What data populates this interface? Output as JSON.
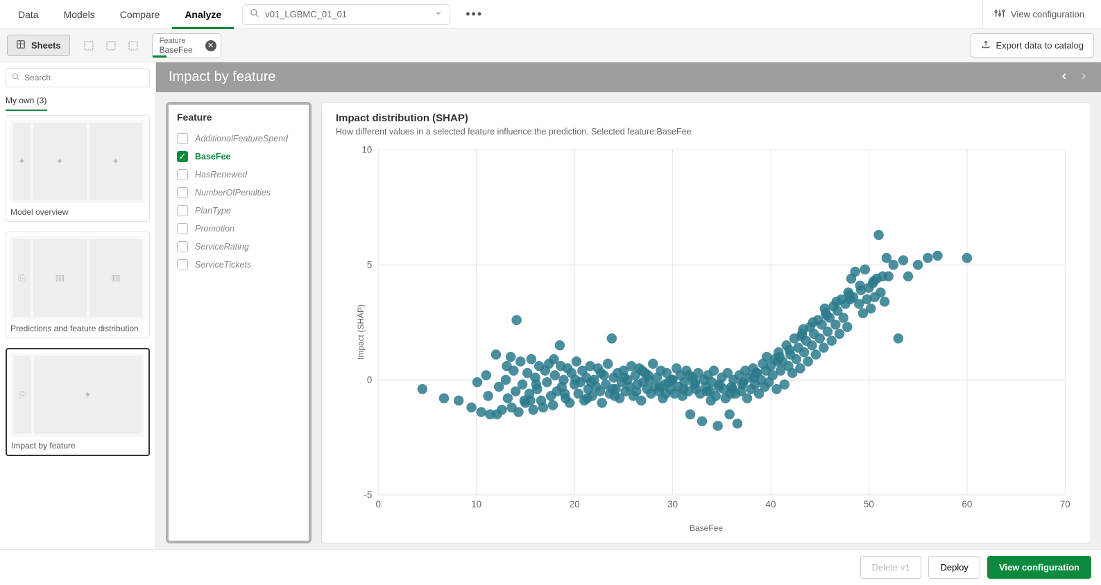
{
  "topnav": {
    "items": [
      "Data",
      "Models",
      "Compare",
      "Analyze"
    ],
    "active": 3
  },
  "model_dropdown": {
    "value": "v01_LGBMC_01_01"
  },
  "view_config_top": "View configuration",
  "sheets_btn": "Sheets",
  "feature_chip": {
    "label": "Feature",
    "value": "BaseFee"
  },
  "export_btn": "Export data to catalog",
  "search": {
    "placeholder": "Search"
  },
  "my_own": {
    "label": "My own (3)"
  },
  "sheets": [
    {
      "title": "Model overview"
    },
    {
      "title": "Predictions and feature distribution"
    },
    {
      "title": "Impact by feature"
    }
  ],
  "selected_sheet": 2,
  "canvas_header": "Impact by feature",
  "feature_panel": {
    "title": "Feature",
    "items": [
      {
        "label": "AdditionalFeatureSpend",
        "checked": false
      },
      {
        "label": "BaseFee",
        "checked": true
      },
      {
        "label": "HasRenewed",
        "checked": false
      },
      {
        "label": "NumberOfPenalties",
        "checked": false
      },
      {
        "label": "PlanType",
        "checked": false
      },
      {
        "label": "Promotion",
        "checked": false
      },
      {
        "label": "ServiceRating",
        "checked": false
      },
      {
        "label": "ServiceTickets",
        "checked": false
      }
    ]
  },
  "chart": {
    "title": "Impact distribution (SHAP)",
    "subtitle": "How different values in a selected feature influence the prediction. Selected feature:BaseFee"
  },
  "footer": {
    "delete": "Delete v1",
    "deploy": "Deploy",
    "view_config": "View configuration"
  },
  "chart_data": {
    "type": "scatter",
    "title": "Impact distribution (SHAP)",
    "xlabel": "BaseFee",
    "ylabel": "Impact (SHAP)",
    "xlim": [
      0,
      70
    ],
    "ylim": [
      -5,
      10
    ],
    "xticks": [
      0,
      10,
      20,
      30,
      40,
      50,
      60,
      70
    ],
    "yticks": [
      -5,
      0,
      5,
      10
    ],
    "point_color": "#2b7a8c",
    "points": [
      [
        4.5,
        -0.4
      ],
      [
        6.7,
        -0.8
      ],
      [
        8.2,
        -0.9
      ],
      [
        9.5,
        -1.2
      ],
      [
        10.1,
        -0.1
      ],
      [
        10.5,
        -1.4
      ],
      [
        11.0,
        0.2
      ],
      [
        11.2,
        -0.7
      ],
      [
        11.4,
        -1.5
      ],
      [
        12.0,
        1.1
      ],
      [
        12.1,
        -1.5
      ],
      [
        12.3,
        -0.3
      ],
      [
        12.6,
        -1.3
      ],
      [
        13.0,
        0.0
      ],
      [
        13.2,
        -0.8
      ],
      [
        13.5,
        1.0
      ],
      [
        13.6,
        -1.2
      ],
      [
        13.8,
        0.4
      ],
      [
        14.0,
        -0.5
      ],
      [
        14.1,
        2.6
      ],
      [
        14.3,
        -1.4
      ],
      [
        14.5,
        0.8
      ],
      [
        14.7,
        -0.2
      ],
      [
        15.0,
        -1.0
      ],
      [
        15.2,
        0.3
      ],
      [
        15.4,
        -0.6
      ],
      [
        15.6,
        0.9
      ],
      [
        15.8,
        -1.3
      ],
      [
        16.0,
        0.1
      ],
      [
        16.2,
        -0.4
      ],
      [
        16.4,
        0.6
      ],
      [
        16.6,
        -0.9
      ],
      [
        16.8,
        -1.2
      ],
      [
        17.0,
        0.4
      ],
      [
        17.2,
        -0.1
      ],
      [
        17.4,
        0.7
      ],
      [
        17.6,
        -0.7
      ],
      [
        17.8,
        -1.1
      ],
      [
        18.0,
        0.2
      ],
      [
        18.2,
        -0.5
      ],
      [
        18.5,
        1.5
      ],
      [
        18.7,
        -0.3
      ],
      [
        18.9,
        0.0
      ],
      [
        19.1,
        -0.8
      ],
      [
        19.3,
        0.5
      ],
      [
        19.5,
        -1.0
      ],
      [
        19.7,
        0.3
      ],
      [
        20.0,
        -0.2
      ],
      [
        20.2,
        0.8
      ],
      [
        20.4,
        -0.6
      ],
      [
        20.6,
        -0.1
      ],
      [
        20.8,
        0.4
      ],
      [
        21.0,
        -0.9
      ],
      [
        21.2,
        0.1
      ],
      [
        21.4,
        -0.4
      ],
      [
        21.6,
        0.6
      ],
      [
        21.8,
        -0.7
      ],
      [
        22.0,
        0.0
      ],
      [
        22.2,
        -0.3
      ],
      [
        22.4,
        0.5
      ],
      [
        22.6,
        -0.5
      ],
      [
        22.8,
        -1.0
      ],
      [
        23.0,
        0.2
      ],
      [
        23.2,
        -0.2
      ],
      [
        23.4,
        0.7
      ],
      [
        23.6,
        -0.6
      ],
      [
        23.8,
        1.8
      ],
      [
        24.0,
        0.1
      ],
      [
        24.2,
        -0.4
      ],
      [
        24.4,
        0.3
      ],
      [
        24.6,
        -0.8
      ],
      [
        24.8,
        -0.1
      ],
      [
        25.0,
        0.4
      ],
      [
        25.2,
        -0.5
      ],
      [
        25.4,
        0.0
      ],
      [
        25.6,
        -0.3
      ],
      [
        25.8,
        0.6
      ],
      [
        26.0,
        -0.7
      ],
      [
        26.2,
        0.2
      ],
      [
        26.4,
        -0.2
      ],
      [
        26.6,
        0.5
      ],
      [
        26.8,
        -0.9
      ],
      [
        27.0,
        -0.1
      ],
      [
        27.2,
        0.3
      ],
      [
        27.4,
        -0.4
      ],
      [
        27.6,
        0.0
      ],
      [
        27.8,
        -0.6
      ],
      [
        28.0,
        0.7
      ],
      [
        28.2,
        -0.3
      ],
      [
        28.4,
        0.1
      ],
      [
        28.6,
        -0.5
      ],
      [
        28.8,
        0.4
      ],
      [
        29.0,
        -0.8
      ],
      [
        29.2,
        -0.2
      ],
      [
        29.4,
        0.3
      ],
      [
        29.6,
        -0.1
      ],
      [
        29.8,
        -0.4
      ],
      [
        30.0,
        0.0
      ],
      [
        30.2,
        -0.6
      ],
      [
        30.4,
        0.5
      ],
      [
        30.6,
        -0.3
      ],
      [
        30.8,
        0.2
      ],
      [
        31.0,
        -0.7
      ],
      [
        31.2,
        -0.1
      ],
      [
        31.4,
        0.4
      ],
      [
        31.6,
        -0.5
      ],
      [
        31.8,
        -1.5
      ],
      [
        32.0,
        0.1
      ],
      [
        32.2,
        -0.2
      ],
      [
        32.4,
        -0.4
      ],
      [
        32.6,
        0.3
      ],
      [
        32.8,
        -0.6
      ],
      [
        33.0,
        -1.8
      ],
      [
        33.2,
        0.0
      ],
      [
        33.4,
        -0.3
      ],
      [
        33.6,
        0.2
      ],
      [
        33.8,
        -0.5
      ],
      [
        34.0,
        -0.1
      ],
      [
        34.2,
        0.4
      ],
      [
        34.4,
        -0.7
      ],
      [
        34.6,
        -2.0
      ],
      [
        34.8,
        -0.2
      ],
      [
        35.0,
        0.1
      ],
      [
        35.2,
        -0.4
      ],
      [
        35.4,
        -0.8
      ],
      [
        35.6,
        0.3
      ],
      [
        35.8,
        -1.5
      ],
      [
        36.0,
        -0.3
      ],
      [
        36.2,
        0.0
      ],
      [
        36.4,
        -0.6
      ],
      [
        36.6,
        -1.9
      ],
      [
        36.8,
        0.2
      ],
      [
        37.0,
        -0.5
      ],
      [
        37.2,
        -0.1
      ],
      [
        37.4,
        0.4
      ],
      [
        37.6,
        -0.8
      ],
      [
        37.8,
        0.1
      ],
      [
        38.0,
        -0.4
      ],
      [
        38.2,
        0.5
      ],
      [
        38.4,
        -0.2
      ],
      [
        38.6,
        0.3
      ],
      [
        38.8,
        -0.6
      ],
      [
        39.0,
        0.0
      ],
      [
        39.2,
        0.7
      ],
      [
        39.4,
        -0.3
      ],
      [
        39.6,
        1.0
      ],
      [
        39.8,
        -0.1
      ],
      [
        40.0,
        0.6
      ],
      [
        40.2,
        0.2
      ],
      [
        40.4,
        0.9
      ],
      [
        40.6,
        -0.4
      ],
      [
        40.8,
        1.2
      ],
      [
        41.0,
        0.4
      ],
      [
        41.2,
        0.8
      ],
      [
        41.4,
        -0.2
      ],
      [
        41.6,
        1.5
      ],
      [
        41.8,
        0.6
      ],
      [
        42.0,
        1.1
      ],
      [
        42.2,
        0.3
      ],
      [
        42.4,
        1.8
      ],
      [
        42.6,
        0.9
      ],
      [
        42.8,
        1.4
      ],
      [
        43.0,
        0.5
      ],
      [
        43.2,
        2.0
      ],
      [
        43.4,
        1.2
      ],
      [
        43.6,
        1.7
      ],
      [
        43.8,
        0.8
      ],
      [
        44.0,
        2.3
      ],
      [
        44.2,
        1.5
      ],
      [
        44.4,
        2.0
      ],
      [
        44.6,
        1.1
      ],
      [
        44.8,
        2.6
      ],
      [
        45.0,
        1.8
      ],
      [
        45.2,
        2.4
      ],
      [
        45.4,
        1.4
      ],
      [
        45.6,
        2.9
      ],
      [
        45.8,
        2.1
      ],
      [
        46.0,
        2.7
      ],
      [
        46.2,
        1.7
      ],
      [
        46.4,
        3.2
      ],
      [
        46.6,
        2.4
      ],
      [
        46.8,
        3.0
      ],
      [
        47.0,
        2.0
      ],
      [
        47.2,
        3.5
      ],
      [
        47.4,
        2.7
      ],
      [
        47.6,
        3.3
      ],
      [
        47.8,
        2.3
      ],
      [
        48.0,
        3.7
      ],
      [
        48.2,
        4.4
      ],
      [
        48.4,
        3.6
      ],
      [
        48.6,
        4.7
      ],
      [
        49.0,
        3.3
      ],
      [
        49.2,
        3.9
      ],
      [
        49.4,
        2.9
      ],
      [
        49.6,
        4.8
      ],
      [
        49.8,
        3.5
      ],
      [
        50.0,
        4.0
      ],
      [
        50.2,
        3.1
      ],
      [
        50.4,
        4.2
      ],
      [
        50.6,
        3.6
      ],
      [
        50.8,
        4.4
      ],
      [
        51.0,
        6.3
      ],
      [
        51.2,
        3.8
      ],
      [
        51.4,
        4.5
      ],
      [
        51.6,
        3.4
      ],
      [
        51.8,
        5.3
      ],
      [
        52.0,
        4.5
      ],
      [
        52.5,
        5.0
      ],
      [
        53.0,
        1.8
      ],
      [
        53.5,
        5.2
      ],
      [
        54.0,
        4.5
      ],
      [
        55.0,
        5.0
      ],
      [
        56.0,
        5.3
      ],
      [
        57.0,
        5.4
      ],
      [
        60.0,
        5.3
      ],
      [
        13.1,
        0.6
      ],
      [
        14.9,
        -0.9
      ],
      [
        16.1,
        -0.2
      ],
      [
        17.9,
        0.9
      ],
      [
        19.0,
        -0.6
      ],
      [
        20.1,
        0.0
      ],
      [
        21.3,
        -0.8
      ],
      [
        22.7,
        0.3
      ],
      [
        23.9,
        -0.4
      ],
      [
        25.1,
        0.1
      ],
      [
        26.3,
        -0.5
      ],
      [
        27.5,
        0.2
      ],
      [
        28.7,
        -0.3
      ],
      [
        29.9,
        0.0
      ],
      [
        31.1,
        -0.4
      ],
      [
        32.3,
        -0.1
      ],
      [
        33.5,
        -0.5
      ],
      [
        34.7,
        -0.3
      ],
      [
        35.9,
        -0.6
      ],
      [
        37.1,
        -0.2
      ],
      [
        38.3,
        0.1
      ],
      [
        39.5,
        0.4
      ],
      [
        40.7,
        0.8
      ],
      [
        41.9,
        1.3
      ],
      [
        43.1,
        1.9
      ],
      [
        44.3,
        2.5
      ],
      [
        45.5,
        3.1
      ],
      [
        46.7,
        3.4
      ],
      [
        47.9,
        3.8
      ],
      [
        49.1,
        4.1
      ],
      [
        15.5,
        -0.9
      ],
      [
        18.6,
        0.6
      ],
      [
        21.7,
        -0.1
      ],
      [
        24.1,
        -0.7
      ],
      [
        26.9,
        0.4
      ],
      [
        29.3,
        -0.6
      ],
      [
        31.7,
        0.2
      ],
      [
        33.9,
        -0.9
      ],
      [
        36.1,
        -0.4
      ],
      [
        38.5,
        0.3
      ],
      [
        40.9,
        1.0
      ],
      [
        43.3,
        2.2
      ],
      [
        45.7,
        2.8
      ],
      [
        48.1,
        3.5
      ],
      [
        50.5,
        4.3
      ]
    ]
  }
}
